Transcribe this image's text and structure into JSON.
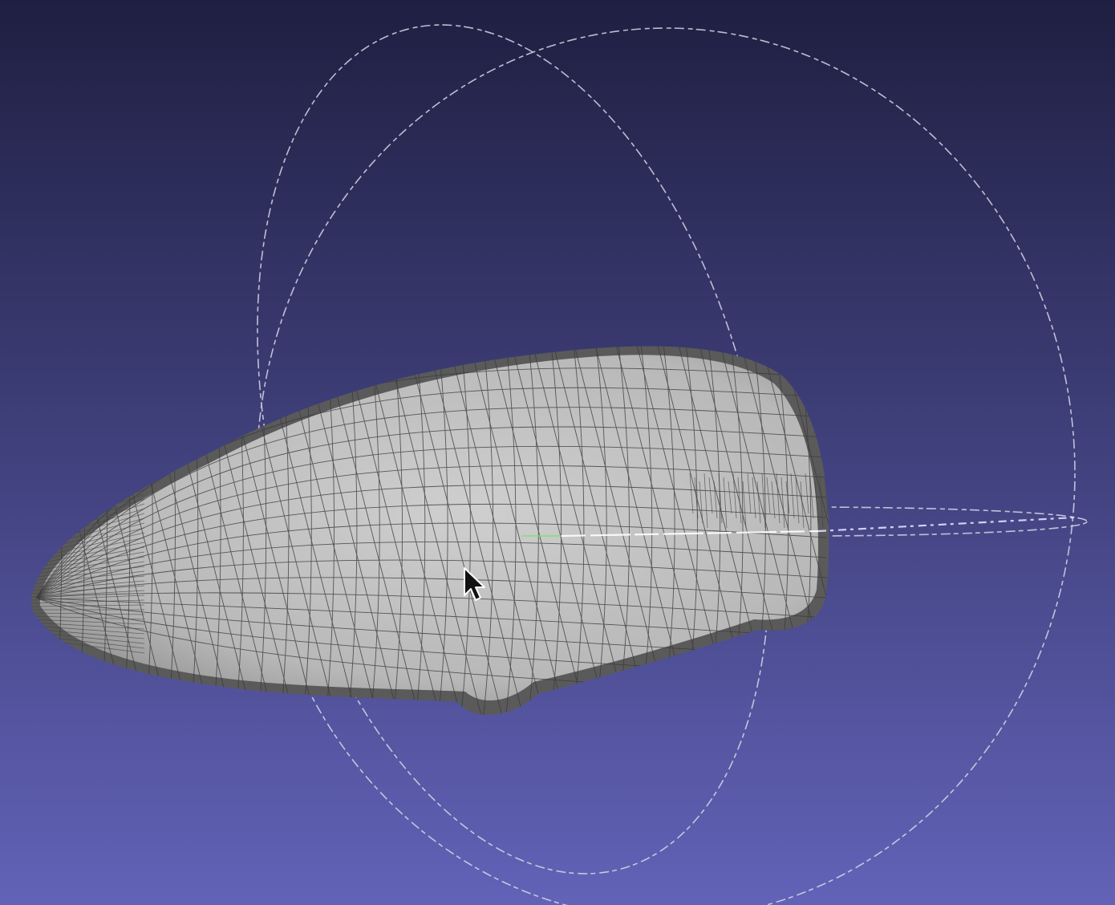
{
  "viewport": {
    "background_top": "#1f1f42",
    "background_bottom": "#6262b8"
  },
  "mesh": {
    "render_mode": "wireframe-over-shaded",
    "fill_color": "#c2c2c2",
    "wire_color": "#3a3a3a",
    "edge_color": "#555555"
  },
  "trackball": {
    "ring_color": "#d8d8e8",
    "axis_highlight_color": "#ffffff",
    "axis_accent_color": "#7fe07f"
  },
  "cursor": {
    "icon": "arrow-pointer-icon",
    "color": "#111111",
    "outline": "#ffffff"
  }
}
